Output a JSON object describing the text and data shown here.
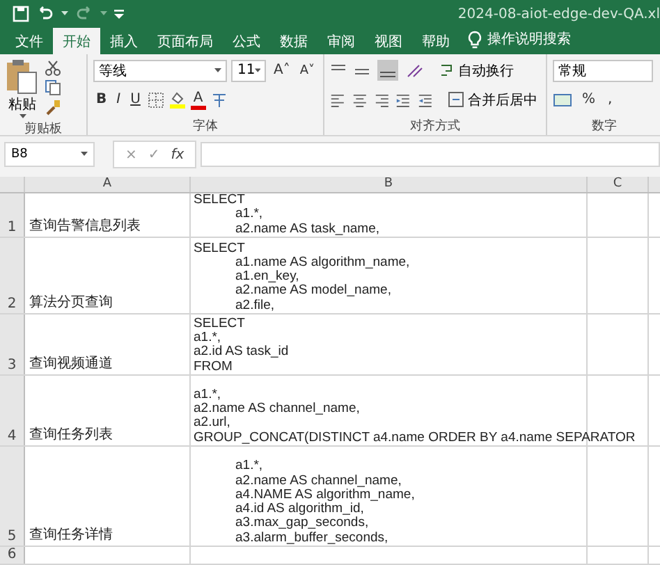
{
  "window": {
    "title": "2024-08-aiot-edge-dev-QA.xl"
  },
  "tabs": [
    {
      "label": "文件",
      "selected": false
    },
    {
      "label": "开始",
      "selected": true
    },
    {
      "label": "插入",
      "selected": false
    },
    {
      "label": "页面布局",
      "selected": false
    },
    {
      "label": "公式",
      "selected": false
    },
    {
      "label": "数据",
      "selected": false
    },
    {
      "label": "审阅",
      "selected": false
    },
    {
      "label": "视图",
      "selected": false
    },
    {
      "label": "帮助",
      "selected": false
    }
  ],
  "tell_me": "操作说明搜索",
  "ribbon": {
    "clipboard": {
      "paste": "粘贴",
      "label": "剪贴板"
    },
    "font": {
      "name": "等线",
      "size": "11",
      "grow": "A˄",
      "shrink": "A˅",
      "bold": "B",
      "italic": "I",
      "underline": "U",
      "color_letter": "A",
      "label": "字体"
    },
    "alignment": {
      "wrap": "自动换行",
      "merge": "合并后居中",
      "label": "对齐方式"
    },
    "number": {
      "format": "常规",
      "percent": "%",
      "comma": ",",
      "label": "数字"
    }
  },
  "formula_bar": {
    "name_box": "B8",
    "cancel": "×",
    "enter": "✓",
    "fx": "fx"
  },
  "columns": [
    {
      "label": "A",
      "kind": "normal"
    },
    {
      "label": "B",
      "kind": "normal"
    },
    {
      "label": "C",
      "kind": "normal"
    }
  ],
  "rows": [
    {
      "number": "1",
      "name": "查询告警信息列表",
      "sql": {
        "lines": [
          "SELECT"
        ],
        "children": [
          "a1.*,",
          "a2.name AS task_name,"
        ]
      }
    },
    {
      "number": "2",
      "name": "算法分页查询",
      "sql": {
        "lines": [
          "SELECT"
        ],
        "children": [
          "a1.name AS algorithm_name,",
          "a1.en_key,",
          "a2.name AS model_name,",
          "a2.file,"
        ]
      }
    },
    {
      "number": "3",
      "name": "查询视频通道",
      "sql": {
        "lines": [
          "SELECT",
          "a1.*,",
          "a2.id AS task_id",
          "FROM"
        ]
      }
    },
    {
      "number": "4",
      "name": "查询任务列表",
      "sql": {
        "lines": [
          "a1.*,",
          "a2.name AS channel_name,",
          "a2.url,",
          "GROUP_CONCAT(DISTINCT a4.name ORDER BY a4.name SEPARATOR"
        ]
      }
    },
    {
      "number": "5",
      "name": "查询任务详情",
      "sql": {
        "children": [
          "a1.*,",
          "a2.name AS channel_name,",
          "a4.NAME AS algorithm_name,",
          "a4.id AS algorithm_id,",
          "a3.max_gap_seconds,",
          "a3.alarm_buffer_seconds,"
        ]
      }
    },
    {
      "number": "6"
    }
  ]
}
